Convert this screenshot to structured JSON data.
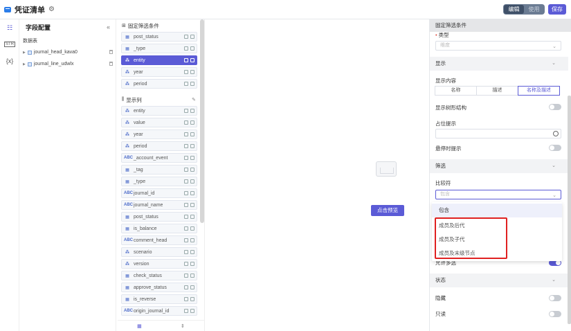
{
  "topbar": {
    "title": "凭证清单",
    "mode_edit": "编辑",
    "mode_use": "使用",
    "save_label": "保存"
  },
  "iconbar": {
    "items": [
      "field-config-icon",
      "string-icon",
      "variable-icon"
    ],
    "string_glyph": "STR",
    "variable_glyph": "{x}"
  },
  "field_panel": {
    "title": "字段配置",
    "datasource_label": "数据表",
    "tables": [
      "journal_head_kava0",
      "journal_line_udwlx"
    ]
  },
  "fixed_filter": {
    "title": "固定筛选条件",
    "items": [
      {
        "name": "post_status",
        "type": "dim"
      },
      {
        "name": "_type",
        "type": "dim"
      },
      {
        "name": "entity",
        "type": "hier",
        "selected": true
      },
      {
        "name": "year",
        "type": "hier"
      },
      {
        "name": "period",
        "type": "hier"
      }
    ]
  },
  "display_cols": {
    "title": "显示列",
    "items": [
      {
        "name": "entity",
        "type": "hier"
      },
      {
        "name": "value",
        "type": "hier"
      },
      {
        "name": "year",
        "type": "hier"
      },
      {
        "name": "period",
        "type": "hier"
      },
      {
        "name": "_account_event",
        "type": "abc"
      },
      {
        "name": "_tag",
        "type": "dim"
      },
      {
        "name": "_type",
        "type": "dim"
      },
      {
        "name": "journal_id",
        "type": "abc"
      },
      {
        "name": "journal_name",
        "type": "abc"
      },
      {
        "name": "post_status",
        "type": "dim"
      },
      {
        "name": "is_balance",
        "type": "dim"
      },
      {
        "name": "comment_head",
        "type": "abc"
      },
      {
        "name": "scenario",
        "type": "hier"
      },
      {
        "name": "version",
        "type": "hier"
      },
      {
        "name": "check_status",
        "type": "dim"
      },
      {
        "name": "approve_status",
        "type": "dim"
      },
      {
        "name": "is_reverse",
        "type": "dim"
      },
      {
        "name": "origin_journal_id",
        "type": "abc"
      }
    ]
  },
  "type_glyphs": {
    "dim": "▦",
    "hier": "⁂",
    "abc": "ABC"
  },
  "canvas": {
    "preview_label": "点击预览"
  },
  "right_panel": {
    "header": "固定筛选条件",
    "type_label": "类型",
    "type_value": "维度",
    "display_section": "显示",
    "display_content_label": "显示内容",
    "display_options": [
      "名称",
      "描述",
      "名称及描述"
    ],
    "display_selected": 2,
    "tree_label": "显示树形结构",
    "tree_on": false,
    "placeholder_label": "占位提示",
    "hover_label": "悬停时提示",
    "hover_on": false,
    "filter_section": "筛选",
    "comparator_label": "比较符",
    "comparator_value": "包含",
    "multi_label": "允许多选",
    "multi_on": true,
    "state_section": "状态",
    "hidden_label": "隐藏",
    "hidden_on": false,
    "readonly_label": "只读",
    "readonly_on": false
  },
  "dropdown": {
    "options": [
      "包含",
      "成员及后代",
      "成员及子代",
      "成员及末级节点"
    ],
    "highlighted": 0
  }
}
